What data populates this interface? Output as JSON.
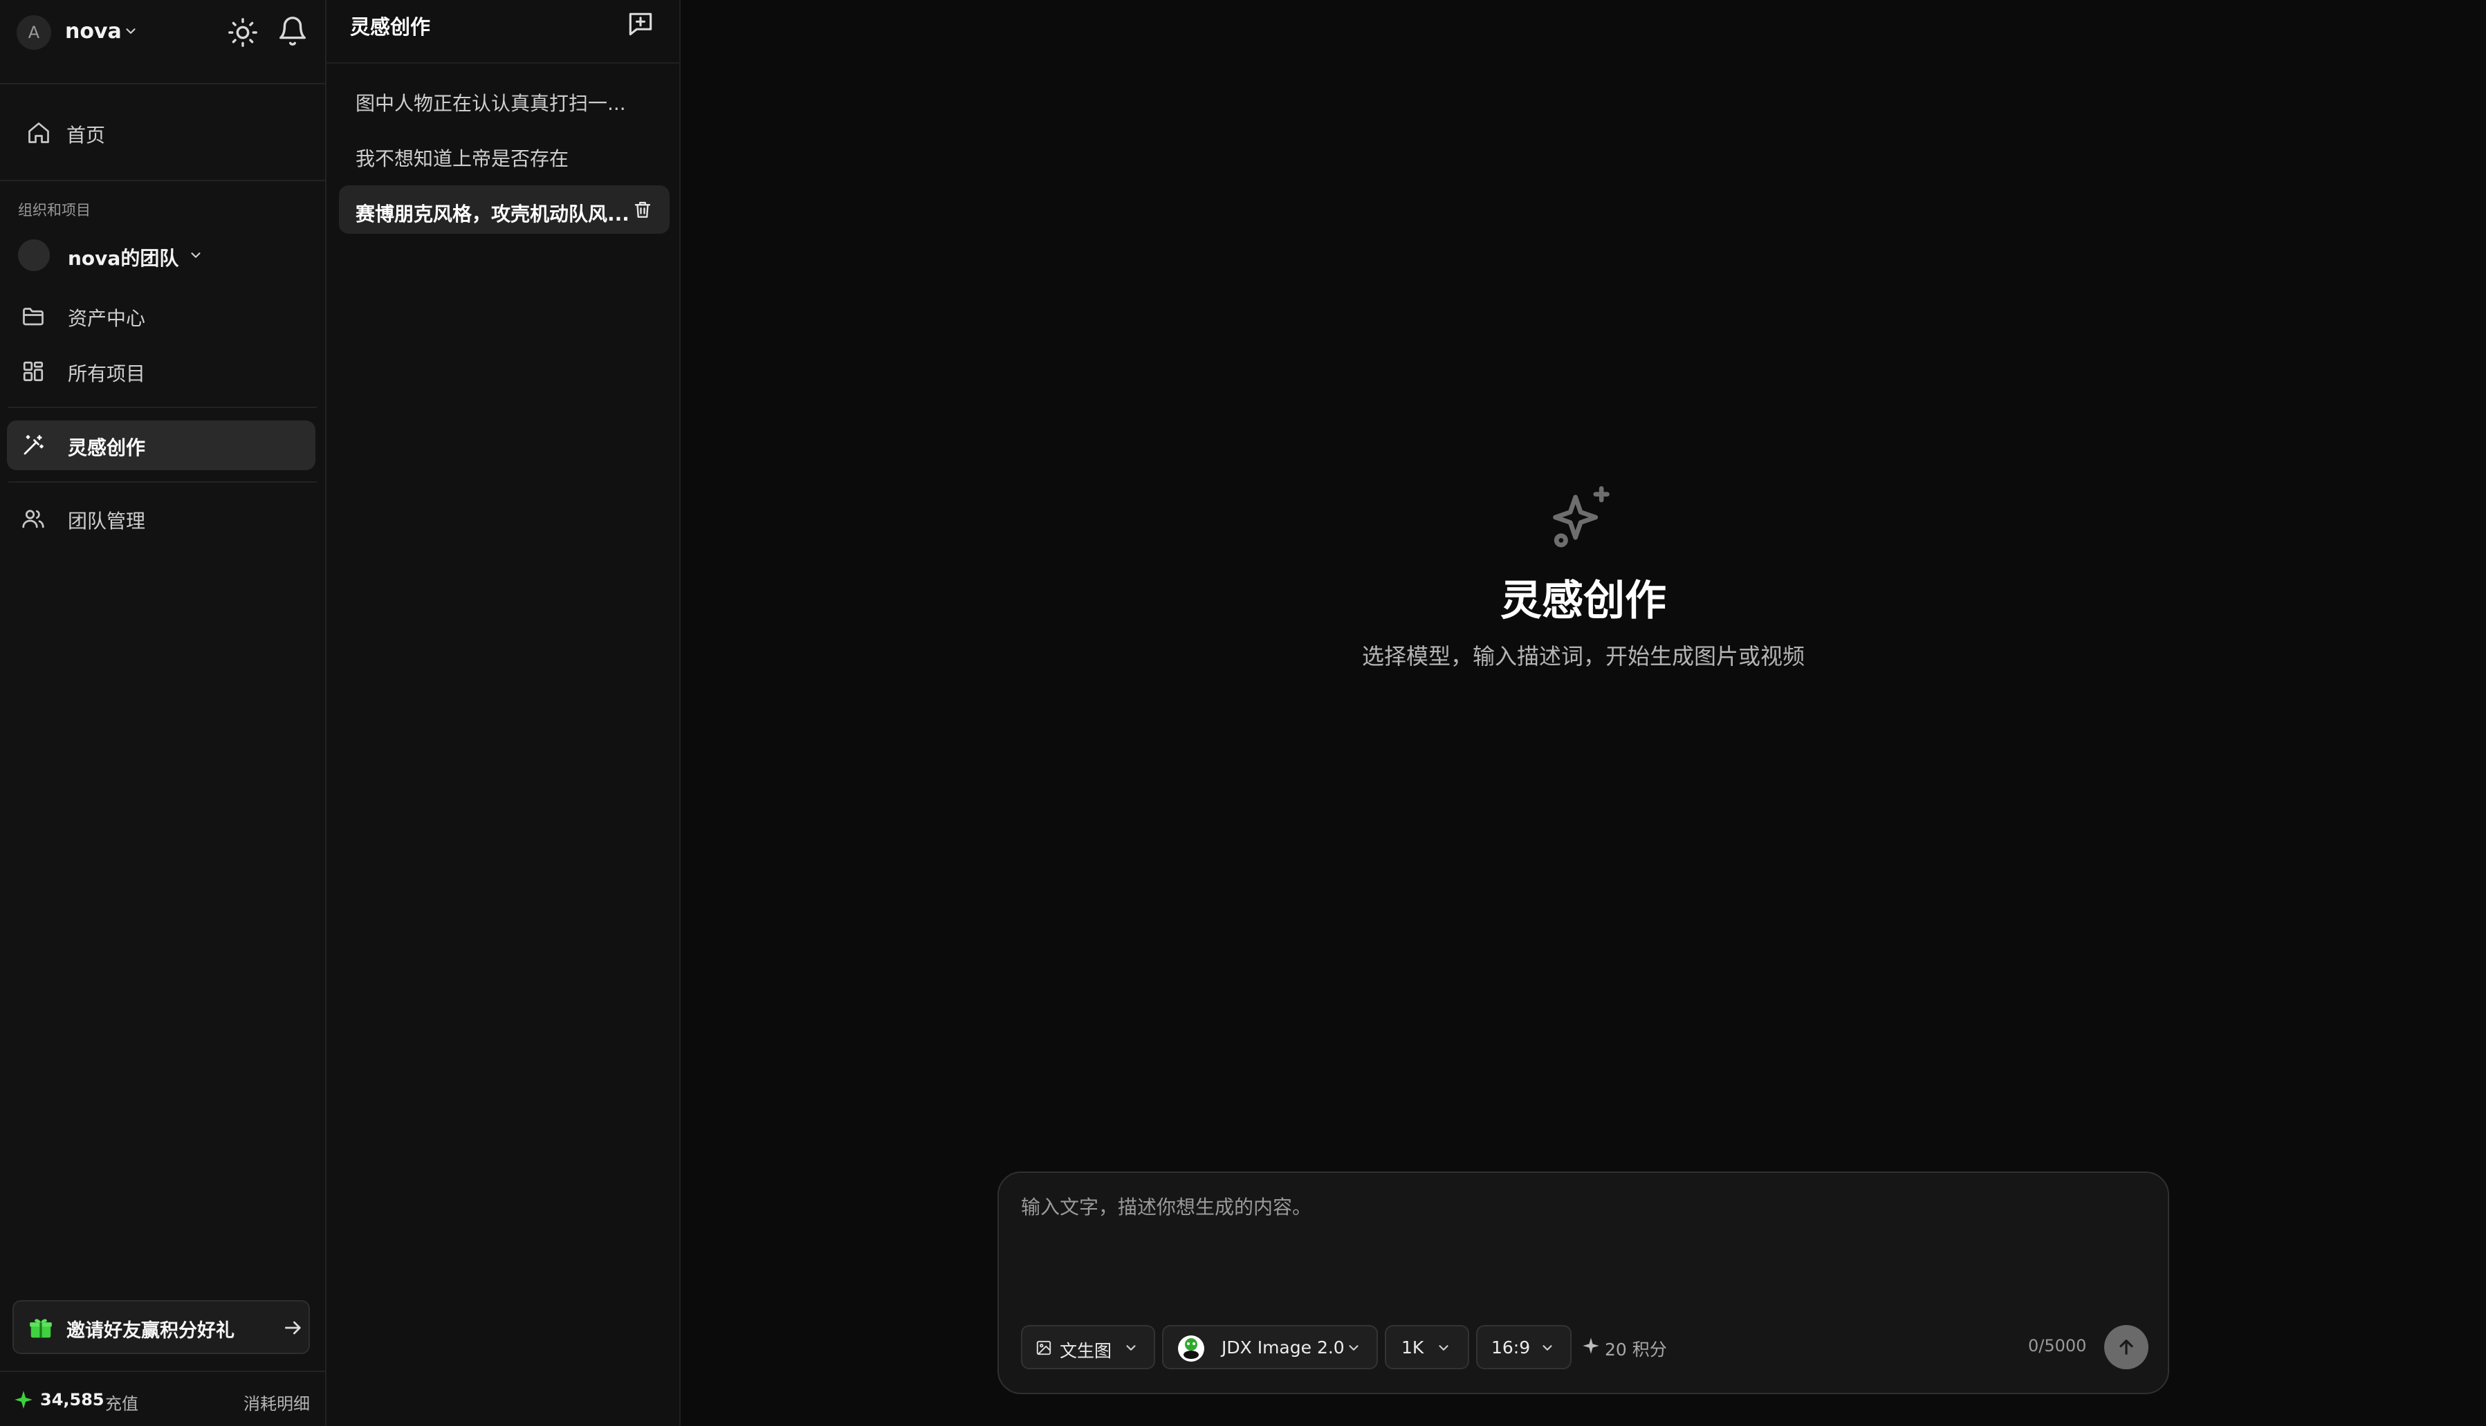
{
  "user": {
    "avatar_letter": "A",
    "name": "nova"
  },
  "sidebar": {
    "home_label": "首页",
    "section_label": "组织和项目",
    "team_name": "nova的团队",
    "items": [
      {
        "label": "资产中心",
        "icon": "folder-icon"
      },
      {
        "label": "所有项目",
        "icon": "grid-icon"
      },
      {
        "label": "灵感创作",
        "icon": "magic-wand-icon",
        "active": true
      },
      {
        "label": "团队管理",
        "icon": "users-icon"
      }
    ],
    "invite_label": "邀请好友赢积分好礼",
    "credits": "34,585",
    "recharge_label": "充值",
    "details_label": "消耗明细"
  },
  "conversations": {
    "title": "灵感创作",
    "items": [
      {
        "label": "图中人物正在认认真真打扫一..."
      },
      {
        "label": "我不想知道上帝是否存在"
      },
      {
        "label": "赛博朋克风格，攻壳机动队风...",
        "active": true
      }
    ]
  },
  "main": {
    "title": "灵感创作",
    "subtitle": "选择模型，输入描述词，开始生成图片或视频"
  },
  "composer": {
    "placeholder": "输入文字，描述你想生成的内容。",
    "mode_label": "文生图",
    "model_label": "JDX Image 2.0",
    "resolution_label": "1K",
    "ratio_label": "16:9",
    "cost_label": "20 积分",
    "counter": "0/5000"
  },
  "colors": {
    "accent_green": "#3fd13f",
    "background": "#0b0b0b",
    "sidebar": "#121212"
  }
}
